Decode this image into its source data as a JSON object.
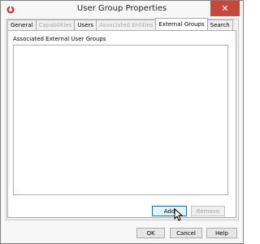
{
  "window": {
    "title": "User Group Properties",
    "close_glyph": "✕"
  },
  "tabs": [
    {
      "label": "General",
      "state": "normal"
    },
    {
      "label": "Capabilities",
      "state": "disabled"
    },
    {
      "label": "Users",
      "state": "normal"
    },
    {
      "label": "Associated Entities",
      "state": "disabled"
    },
    {
      "label": "External Groups",
      "state": "active"
    },
    {
      "label": "Search",
      "state": "normal"
    }
  ],
  "panel": {
    "section_label": "Associated External User Groups",
    "add_label": "Add",
    "remove_label": "Remove"
  },
  "footer": {
    "ok_label": "OK",
    "cancel_label": "Cancel",
    "help_label": "Help"
  },
  "colors": {
    "accent": "#0078d7",
    "close": "#c7483b",
    "app_icon": "#d32f2f"
  }
}
